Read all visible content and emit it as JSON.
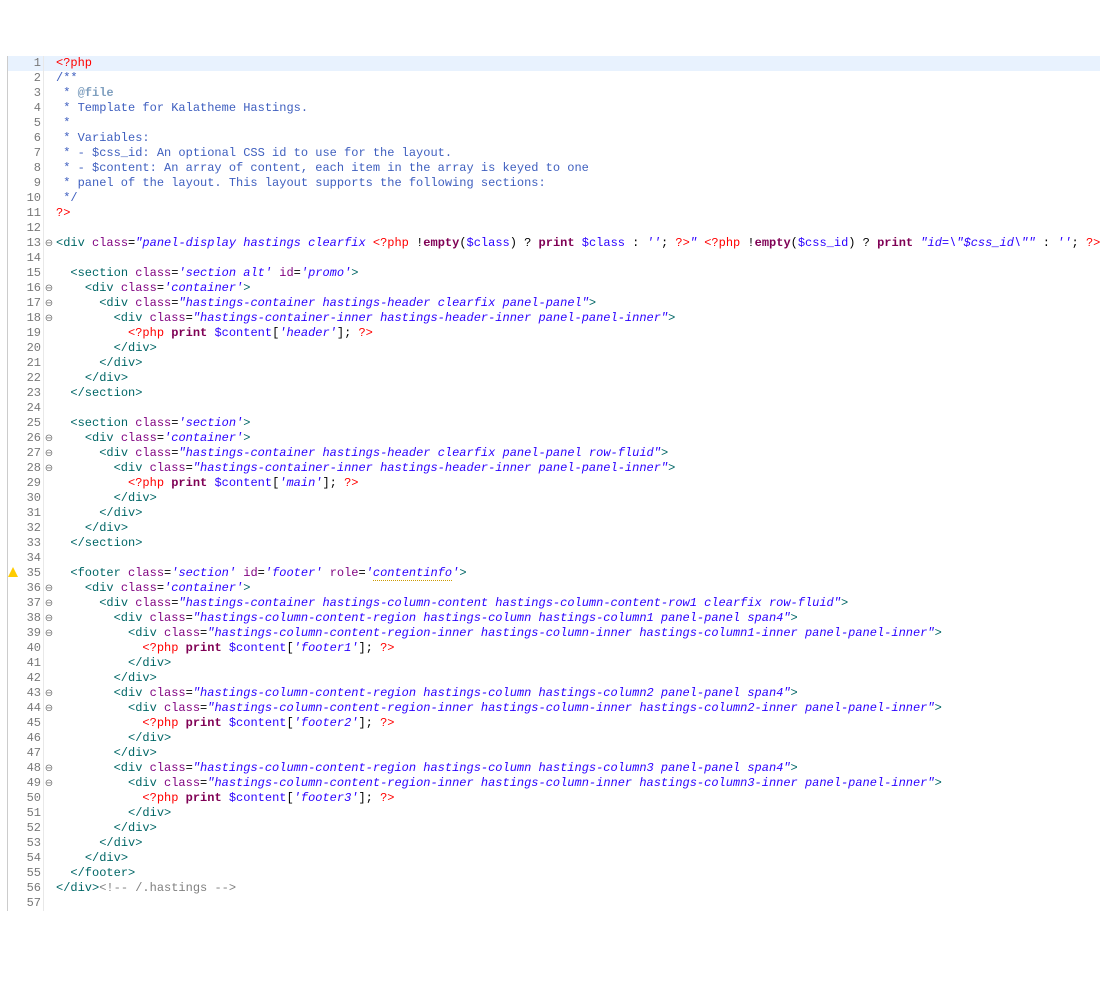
{
  "file_type": "PHP Template",
  "code": {
    "lines": [
      {
        "n": 1,
        "fold": "",
        "mark": "",
        "current": true,
        "html": "<span class='t-php'>&lt;?php</span>"
      },
      {
        "n": 2,
        "fold": "",
        "mark": "",
        "html": "<span class='t-com'>/**</span>"
      },
      {
        "n": 3,
        "fold": "",
        "mark": "",
        "html": "<span class='t-com'> * </span><span class='t-ckw'>@file</span>"
      },
      {
        "n": 4,
        "fold": "",
        "mark": "",
        "html": "<span class='t-com'> * Template for Kalatheme Hastings.</span>"
      },
      {
        "n": 5,
        "fold": "",
        "mark": "",
        "html": "<span class='t-com'> *</span>"
      },
      {
        "n": 6,
        "fold": "",
        "mark": "",
        "html": "<span class='t-com'> * Variables:</span>"
      },
      {
        "n": 7,
        "fold": "",
        "mark": "",
        "html": "<span class='t-com'> * - $css_id: An optional CSS id to use for the layout.</span>"
      },
      {
        "n": 8,
        "fold": "",
        "mark": "",
        "html": "<span class='t-com'> * - $content: An array of content, each item in the array is keyed to one</span>"
      },
      {
        "n": 9,
        "fold": "",
        "mark": "",
        "html": "<span class='t-com'> * panel of the layout. This layout supports the following sections:</span>"
      },
      {
        "n": 10,
        "fold": "",
        "mark": "",
        "html": "<span class='t-com'> */</span>"
      },
      {
        "n": 11,
        "fold": "",
        "mark": "",
        "html": "<span class='t-php'>?&gt;</span>"
      },
      {
        "n": 12,
        "fold": "",
        "mark": "",
        "html": ""
      },
      {
        "n": 13,
        "fold": "⊖",
        "mark": "",
        "html": "<span class='t-tag'>&lt;div</span> <span class='t-attr'>class</span>=<span class='t-str'>\"panel-display hastings clearfix </span><span class='t-php'>&lt;?php</span> !<span class='t-kw'>empty</span>(<span class='t-var'>$class</span>) ? <span class='t-kw'>print</span> <span class='t-var'>$class</span> : <span class='t-str'>''</span>; <span class='t-php'>?&gt;</span><span class='t-str'>\"</span> <span class='t-php'>&lt;?php</span> !<span class='t-kw'>empty</span>(<span class='t-var'>$css_id</span>) ? <span class='t-kw'>print</span> <span class='t-str'>\"id=\\\"$css_id\\\"\"</span> : <span class='t-str'>''</span>; <span class='t-php'>?&gt;</span><span class='t-tag'>&gt;</span>"
      },
      {
        "n": 14,
        "fold": "",
        "mark": "",
        "html": ""
      },
      {
        "n": 15,
        "fold": "",
        "mark": "",
        "html": "  <span class='t-tag'>&lt;section</span> <span class='t-attr'>class</span>=<span class='t-str'>'section alt'</span> <span class='t-attr'>id</span>=<span class='t-str'>'promo'</span><span class='t-tag'>&gt;</span>"
      },
      {
        "n": 16,
        "fold": "⊖",
        "mark": "",
        "html": "    <span class='t-tag'>&lt;div</span> <span class='t-attr'>class</span>=<span class='t-str'>'container'</span><span class='t-tag'>&gt;</span>"
      },
      {
        "n": 17,
        "fold": "⊖",
        "mark": "",
        "html": "      <span class='t-tag'>&lt;div</span> <span class='t-attr'>class</span>=<span class='t-str'>\"hastings-container hastings-header clearfix panel-panel\"</span><span class='t-tag'>&gt;</span>"
      },
      {
        "n": 18,
        "fold": "⊖",
        "mark": "",
        "html": "        <span class='t-tag'>&lt;div</span> <span class='t-attr'>class</span>=<span class='t-str'>\"hastings-container-inner hastings-header-inner panel-panel-inner\"</span><span class='t-tag'>&gt;</span>"
      },
      {
        "n": 19,
        "fold": "",
        "mark": "",
        "html": "          <span class='t-php'>&lt;?php</span> <span class='t-kw'>print</span> <span class='t-var'>$content</span>[<span class='t-str'>'header'</span>]; <span class='t-php'>?&gt;</span>"
      },
      {
        "n": 20,
        "fold": "",
        "mark": "",
        "html": "        <span class='t-tag'>&lt;/div&gt;</span>"
      },
      {
        "n": 21,
        "fold": "",
        "mark": "",
        "html": "      <span class='t-tag'>&lt;/div&gt;</span>"
      },
      {
        "n": 22,
        "fold": "",
        "mark": "",
        "html": "    <span class='t-tag'>&lt;/div&gt;</span>"
      },
      {
        "n": 23,
        "fold": "",
        "mark": "",
        "html": "  <span class='t-tag'>&lt;/section&gt;</span>"
      },
      {
        "n": 24,
        "fold": "",
        "mark": "",
        "html": ""
      },
      {
        "n": 25,
        "fold": "",
        "mark": "",
        "html": "  <span class='t-tag'>&lt;section</span> <span class='t-attr'>class</span>=<span class='t-str'>'section'</span><span class='t-tag'>&gt;</span>"
      },
      {
        "n": 26,
        "fold": "⊖",
        "mark": "",
        "html": "    <span class='t-tag'>&lt;div</span> <span class='t-attr'>class</span>=<span class='t-str'>'container'</span><span class='t-tag'>&gt;</span>"
      },
      {
        "n": 27,
        "fold": "⊖",
        "mark": "",
        "html": "      <span class='t-tag'>&lt;div</span> <span class='t-attr'>class</span>=<span class='t-str'>\"hastings-container hastings-header clearfix panel-panel row-fluid\"</span><span class='t-tag'>&gt;</span>"
      },
      {
        "n": 28,
        "fold": "⊖",
        "mark": "",
        "html": "        <span class='t-tag'>&lt;div</span> <span class='t-attr'>class</span>=<span class='t-str'>\"hastings-container-inner hastings-header-inner panel-panel-inner\"</span><span class='t-tag'>&gt;</span>"
      },
      {
        "n": 29,
        "fold": "",
        "mark": "",
        "html": "          <span class='t-php'>&lt;?php</span> <span class='t-kw'>print</span> <span class='t-var'>$content</span>[<span class='t-str'>'main'</span>]; <span class='t-php'>?&gt;</span>"
      },
      {
        "n": 30,
        "fold": "",
        "mark": "",
        "html": "        <span class='t-tag'>&lt;/div&gt;</span>"
      },
      {
        "n": 31,
        "fold": "",
        "mark": "",
        "html": "      <span class='t-tag'>&lt;/div&gt;</span>"
      },
      {
        "n": 32,
        "fold": "",
        "mark": "",
        "html": "    <span class='t-tag'>&lt;/div&gt;</span>"
      },
      {
        "n": 33,
        "fold": "",
        "mark": "",
        "html": "  <span class='t-tag'>&lt;/section&gt;</span>"
      },
      {
        "n": 34,
        "fold": "",
        "mark": "",
        "html": ""
      },
      {
        "n": 35,
        "fold": "",
        "mark": "warn",
        "html": "  <span class='t-tag'>&lt;footer</span> <span class='t-attr'>class</span>=<span class='t-str'>'section'</span> <span class='t-attr'>id</span>=<span class='t-str'>'footer'</span> <span class='t-attr'>role</span>=<span class='t-str'>'<span style=\"border-bottom:1px dotted #cc9900;\">contentinfo</span>'</span><span class='t-tag'>&gt;</span>"
      },
      {
        "n": 36,
        "fold": "⊖",
        "mark": "",
        "html": "    <span class='t-tag'>&lt;div</span> <span class='t-attr'>class</span>=<span class='t-str'>'container'</span><span class='t-tag'>&gt;</span>"
      },
      {
        "n": 37,
        "fold": "⊖",
        "mark": "",
        "html": "      <span class='t-tag'>&lt;div</span> <span class='t-attr'>class</span>=<span class='t-str'>\"hastings-container hastings-column-content hastings-column-content-row1 clearfix row-fluid\"</span><span class='t-tag'>&gt;</span>"
      },
      {
        "n": 38,
        "fold": "⊖",
        "mark": "",
        "html": "        <span class='t-tag'>&lt;div</span> <span class='t-attr'>class</span>=<span class='t-str'>\"hastings-column-content-region hastings-column hastings-column1 panel-panel span4\"</span><span class='t-tag'>&gt;</span>"
      },
      {
        "n": 39,
        "fold": "⊖",
        "mark": "",
        "html": "          <span class='t-tag'>&lt;div</span> <span class='t-attr'>class</span>=<span class='t-str'>\"hastings-column-content-region-inner hastings-column-inner hastings-column1-inner panel-panel-inner\"</span><span class='t-tag'>&gt;</span>"
      },
      {
        "n": 40,
        "fold": "",
        "mark": "",
        "html": "            <span class='t-php'>&lt;?php</span> <span class='t-kw'>print</span> <span class='t-var'>$content</span>[<span class='t-str'>'footer1'</span>]; <span class='t-php'>?&gt;</span>"
      },
      {
        "n": 41,
        "fold": "",
        "mark": "",
        "html": "          <span class='t-tag'>&lt;/div&gt;</span>"
      },
      {
        "n": 42,
        "fold": "",
        "mark": "",
        "html": "        <span class='t-tag'>&lt;/div&gt;</span>"
      },
      {
        "n": 43,
        "fold": "⊖",
        "mark": "",
        "html": "        <span class='t-tag'>&lt;div</span> <span class='t-attr'>class</span>=<span class='t-str'>\"hastings-column-content-region hastings-column hastings-column2 panel-panel span4\"</span><span class='t-tag'>&gt;</span>"
      },
      {
        "n": 44,
        "fold": "⊖",
        "mark": "",
        "html": "          <span class='t-tag'>&lt;div</span> <span class='t-attr'>class</span>=<span class='t-str'>\"hastings-column-content-region-inner hastings-column-inner hastings-column2-inner panel-panel-inner\"</span><span class='t-tag'>&gt;</span>"
      },
      {
        "n": 45,
        "fold": "",
        "mark": "",
        "html": "            <span class='t-php'>&lt;?php</span> <span class='t-kw'>print</span> <span class='t-var'>$content</span>[<span class='t-str'>'footer2'</span>]; <span class='t-php'>?&gt;</span>"
      },
      {
        "n": 46,
        "fold": "",
        "mark": "",
        "html": "          <span class='t-tag'>&lt;/div&gt;</span>"
      },
      {
        "n": 47,
        "fold": "",
        "mark": "",
        "html": "        <span class='t-tag'>&lt;/div&gt;</span>"
      },
      {
        "n": 48,
        "fold": "⊖",
        "mark": "",
        "html": "        <span class='t-tag'>&lt;div</span> <span class='t-attr'>class</span>=<span class='t-str'>\"hastings-column-content-region hastings-column hastings-column3 panel-panel span4\"</span><span class='t-tag'>&gt;</span>"
      },
      {
        "n": 49,
        "fold": "⊖",
        "mark": "",
        "html": "          <span class='t-tag'>&lt;div</span> <span class='t-attr'>class</span>=<span class='t-str'>\"hastings-column-content-region-inner hastings-column-inner hastings-column3-inner panel-panel-inner\"</span><span class='t-tag'>&gt;</span>"
      },
      {
        "n": 50,
        "fold": "",
        "mark": "",
        "html": "            <span class='t-php'>&lt;?php</span> <span class='t-kw'>print</span> <span class='t-var'>$content</span>[<span class='t-str'>'footer3'</span>]; <span class='t-php'>?&gt;</span>"
      },
      {
        "n": 51,
        "fold": "",
        "mark": "",
        "html": "          <span class='t-tag'>&lt;/div&gt;</span>"
      },
      {
        "n": 52,
        "fold": "",
        "mark": "",
        "html": "        <span class='t-tag'>&lt;/div&gt;</span>"
      },
      {
        "n": 53,
        "fold": "",
        "mark": "",
        "html": "      <span class='t-tag'>&lt;/div&gt;</span>"
      },
      {
        "n": 54,
        "fold": "",
        "mark": "",
        "html": "    <span class='t-tag'>&lt;/div&gt;</span>"
      },
      {
        "n": 55,
        "fold": "",
        "mark": "",
        "html": "  <span class='t-tag'>&lt;/footer&gt;</span>"
      },
      {
        "n": 56,
        "fold": "",
        "mark": "",
        "html": "<span class='t-tag'>&lt;/div&gt;</span><span class='t-comgrey'>&lt;!-- /.hastings --&gt;</span>"
      },
      {
        "n": 57,
        "fold": "",
        "mark": "",
        "html": ""
      }
    ]
  }
}
